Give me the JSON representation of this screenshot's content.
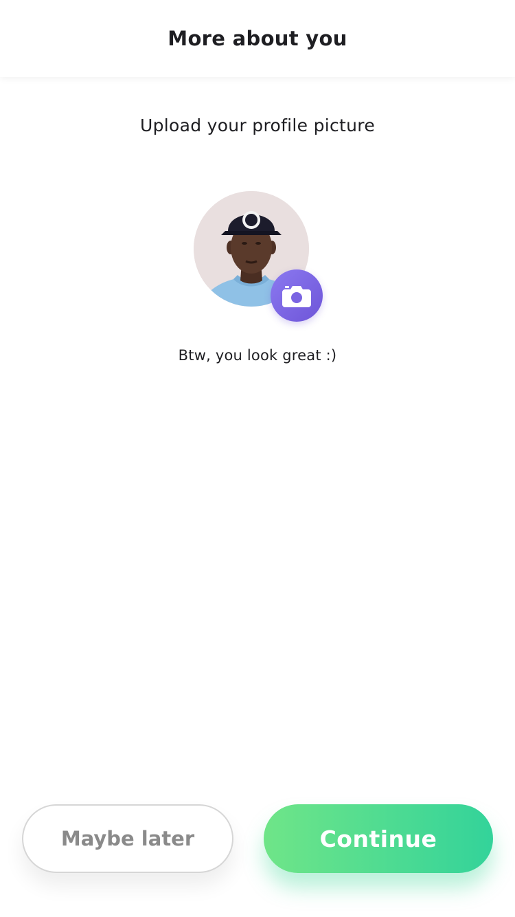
{
  "header": {
    "title": "More about you"
  },
  "main": {
    "subtitle": "Upload your profile picture",
    "avatar_icon": "profile-photo",
    "camera_icon": "camera-icon",
    "caption": "Btw, you look great :)"
  },
  "actions": {
    "later_label": "Maybe later",
    "continue_label": "Continue"
  },
  "colors": {
    "camera_gradient_start": "#8b79f0",
    "camera_gradient_end": "#6e55d8",
    "continue_gradient_start": "#6fe588",
    "continue_gradient_end": "#33d39a",
    "secondary_text": "#8a8a8a"
  }
}
